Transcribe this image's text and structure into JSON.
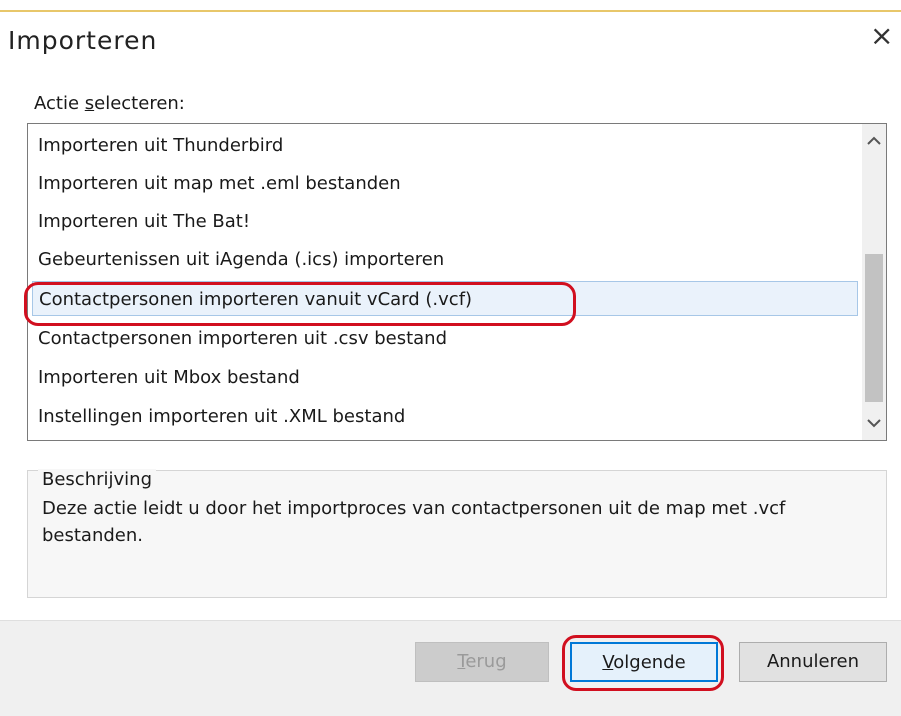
{
  "dialog": {
    "title": "Importeren",
    "close_symbol": "×"
  },
  "action_section": {
    "label_prefix": "Actie ",
    "label_mnemonic": "s",
    "label_suffix": "electeren:"
  },
  "list": {
    "items": [
      {
        "label": "Importeren uit Thunderbird"
      },
      {
        "label": "Importeren uit map met .eml bestanden"
      },
      {
        "label": "Importeren uit The Bat!"
      },
      {
        "label": "Gebeurtenissen uit iAgenda (.ics) importeren"
      },
      {
        "label": "Contactpersonen importeren vanuit vCard (.vcf)",
        "selected": true
      },
      {
        "label": "Contactpersonen importeren uit .csv bestand"
      },
      {
        "label": "Importeren uit Mbox bestand"
      },
      {
        "label": "Instellingen importeren uit .XML bestand"
      }
    ],
    "scroll_up_icon": "chevron-up-icon",
    "scroll_down_icon": "chevron-down-icon"
  },
  "description": {
    "title": "Beschrijving",
    "text": "Deze actie leidt u door het importproces van contactpersonen uit de map met .vcf bestanden."
  },
  "buttons": {
    "back_mnemonic": "T",
    "back_rest": "erug",
    "next_mnemonic": "V",
    "next_rest": "olgende",
    "cancel": "Annuleren"
  },
  "colors": {
    "highlight_outline": "#d10f1f",
    "selection_bg": "#eaf2fb",
    "default_button_border": "#0078d7"
  }
}
